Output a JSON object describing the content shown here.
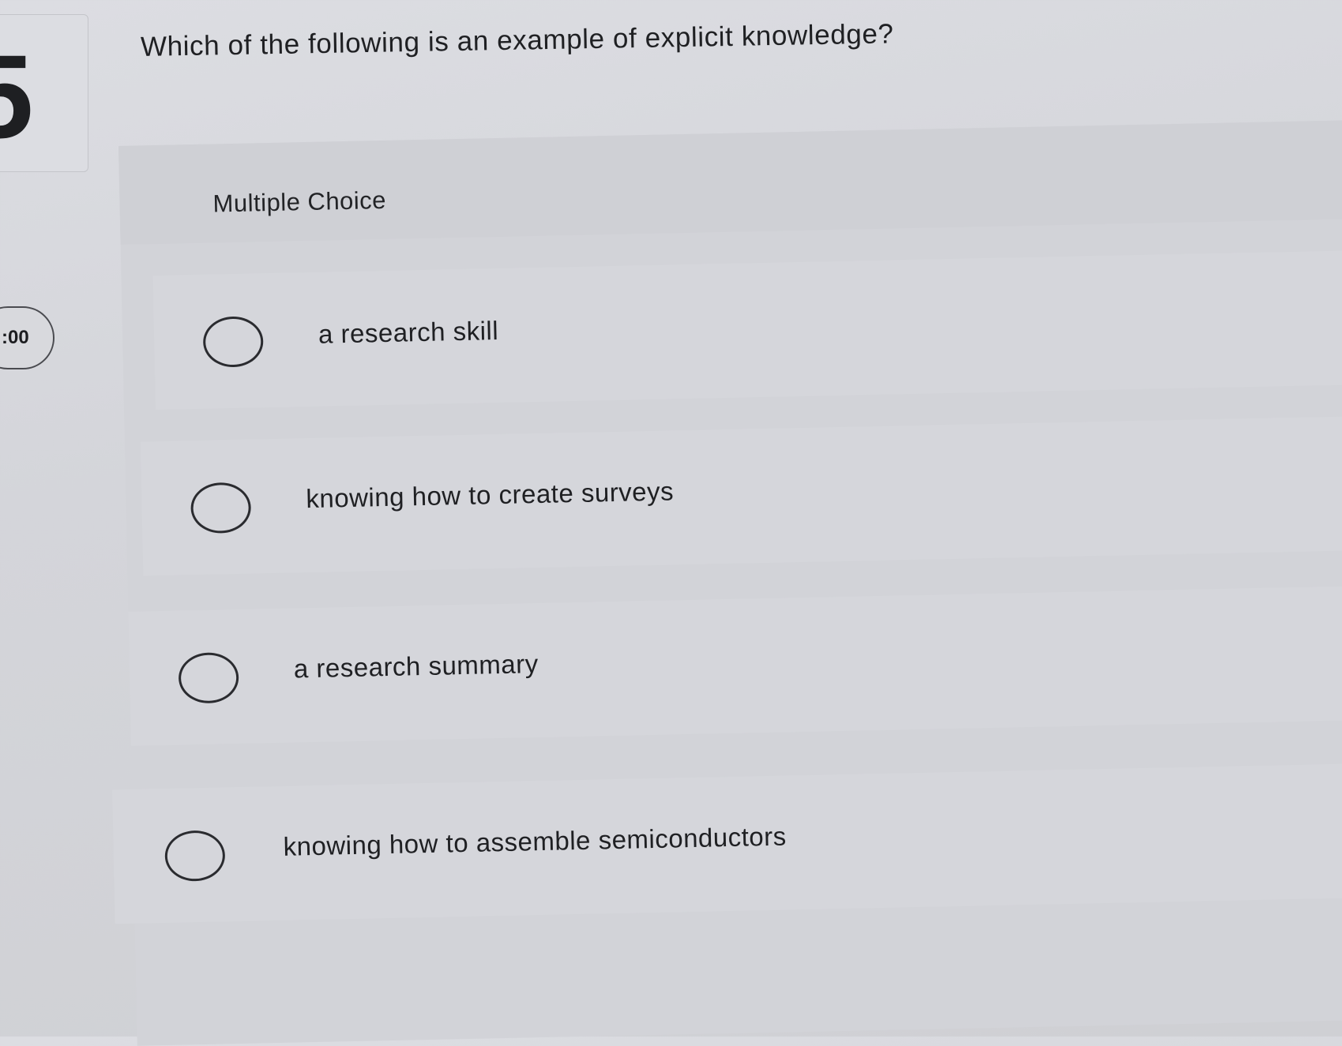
{
  "question_number": "5",
  "timer": ":00",
  "question": {
    "text": "Which of the following is an example of explicit knowledge?"
  },
  "question_type": "Multiple Choice",
  "options": [
    {
      "label": "a research skill"
    },
    {
      "label": "knowing how to create surveys"
    },
    {
      "label": "a research summary"
    },
    {
      "label": "knowing how to assemble semiconductors"
    }
  ]
}
